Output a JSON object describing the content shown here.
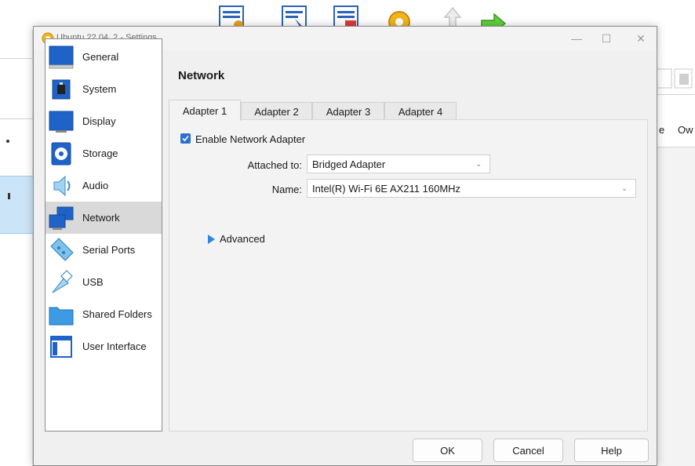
{
  "background": {
    "right_labels": [
      "e",
      "Ow"
    ]
  },
  "dialog": {
    "title": "Ubuntu 22.04_2 - Settings",
    "window_controls": {
      "minimize": "—",
      "maximize": "☐",
      "close": "✕"
    }
  },
  "sidebar": {
    "items": [
      {
        "label": "General",
        "icon": "general-icon"
      },
      {
        "label": "System",
        "icon": "system-icon"
      },
      {
        "label": "Display",
        "icon": "display-icon"
      },
      {
        "label": "Storage",
        "icon": "storage-icon"
      },
      {
        "label": "Audio",
        "icon": "audio-icon"
      },
      {
        "label": "Network",
        "icon": "network-icon",
        "selected": true
      },
      {
        "label": "Serial Ports",
        "icon": "serial-ports-icon"
      },
      {
        "label": "USB",
        "icon": "usb-icon"
      },
      {
        "label": "Shared Folders",
        "icon": "shared-folders-icon"
      },
      {
        "label": "User Interface",
        "icon": "user-interface-icon"
      }
    ]
  },
  "panel": {
    "title": "Network",
    "tabs": [
      "Adapter 1",
      "Adapter 2",
      "Adapter 3",
      "Adapter 4"
    ],
    "active_tab": "Adapter 1",
    "enable_label": "Enable Network Adapter",
    "enable_checked": true,
    "attached_label": "Attached to:",
    "attached_value": "Bridged Adapter",
    "name_label": "Name:",
    "name_value": "Intel(R) Wi-Fi 6E AX211 160MHz",
    "advanced_label": "Advanced"
  },
  "buttons": {
    "ok": "OK",
    "cancel": "Cancel",
    "help": "Help"
  },
  "colors": {
    "accent": "#2b6fd1",
    "selected_item": "#d9d9d9"
  }
}
